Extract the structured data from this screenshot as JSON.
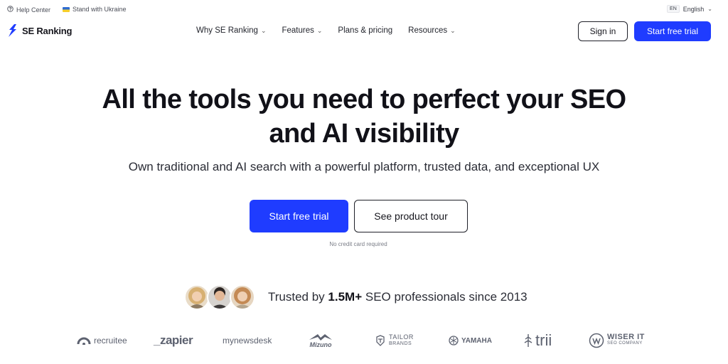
{
  "topbar": {
    "help_label": "Help Center",
    "ukraine_label": "Stand with Ukraine",
    "lang_code": "EN",
    "lang_label": "English"
  },
  "nav": {
    "brand": "SE Ranking",
    "items": [
      {
        "label": "Why SE Ranking",
        "has_dropdown": true
      },
      {
        "label": "Features",
        "has_dropdown": true
      },
      {
        "label": "Plans & pricing",
        "has_dropdown": false
      },
      {
        "label": "Resources",
        "has_dropdown": true
      }
    ],
    "sign_in_label": "Sign in",
    "trial_label": "Start free trial"
  },
  "hero": {
    "title_line1": "All the tools you need to perfect your SEO",
    "title_line2": "and AI visibility",
    "subtitle": "Own traditional and AI search with a powerful platform, trusted data, and exceptional UX",
    "primary_cta": "Start free trial",
    "secondary_cta": "See product tour",
    "note": "No credit card required"
  },
  "trust": {
    "prefix": "Trusted by ",
    "count": "1.5M+",
    "suffix": " SEO professionals since 2013"
  },
  "logos": {
    "recruitee": "recruitee",
    "zapier": "_zapier",
    "newsdesk": "mynewsdesk",
    "mizuno": "Mizuno",
    "tailor_1": "TAILOR",
    "tailor_2": "BRANDS",
    "yamaha": "YAMAHA",
    "trii": "trii",
    "wiser_1": "WISER IT",
    "wiser_2": "SEO COMPANY"
  },
  "colors": {
    "accent": "#1f3cff",
    "text": "#111118",
    "muted": "#5d6270"
  }
}
